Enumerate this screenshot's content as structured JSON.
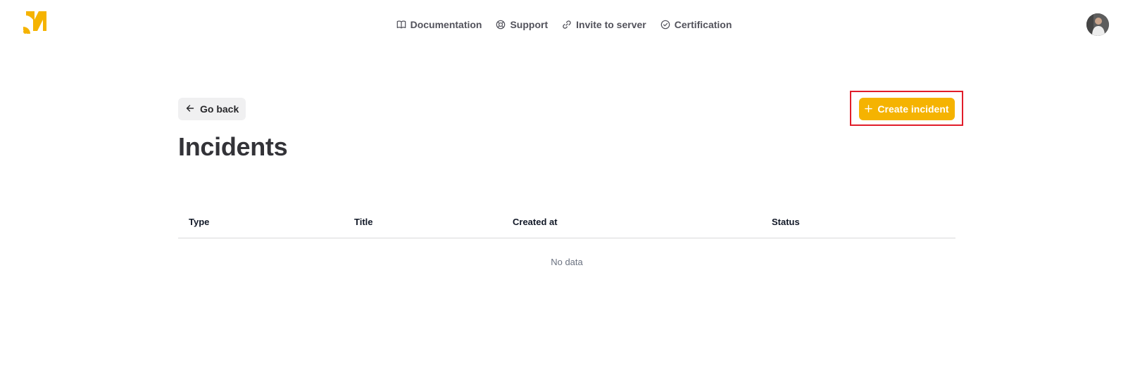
{
  "brand": {
    "logo_icon": "rss-feed-logo-icon",
    "accent_color": "#f5b301"
  },
  "nav": {
    "items": [
      {
        "label": "Documentation",
        "icon": "book-open-icon"
      },
      {
        "label": "Support",
        "icon": "lifebuoy-icon"
      },
      {
        "label": "Invite to server",
        "icon": "link-icon"
      },
      {
        "label": "Certification",
        "icon": "check-circle-icon"
      }
    ]
  },
  "user": {
    "avatar_icon": "user-avatar-icon"
  },
  "actions": {
    "go_back_label": "Go back",
    "go_back_icon": "arrow-left-icon",
    "create_label": "Create incident",
    "create_icon": "plus-icon"
  },
  "page": {
    "title": "Incidents"
  },
  "table": {
    "columns": [
      "Type",
      "Title",
      "Created at",
      "Status"
    ],
    "rows": [],
    "empty_text": "No data"
  },
  "highlight_color": "#e11d2a"
}
